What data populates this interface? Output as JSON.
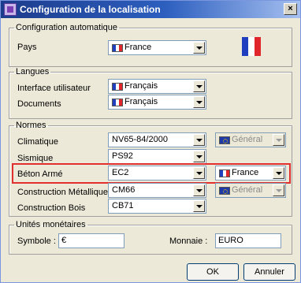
{
  "window": {
    "title": "Configuration de la localisation",
    "close_label": "×"
  },
  "auto_config": {
    "legend": "Configuration automatique",
    "pays_label": "Pays",
    "pays_value": "France"
  },
  "langues": {
    "legend": "Langues",
    "interface_label": "Interface utilisateur",
    "interface_value": "Français",
    "documents_label": "Documents",
    "documents_value": "Français"
  },
  "normes": {
    "legend": "Normes",
    "rows": [
      {
        "label": "Climatique",
        "value": "NV65-84/2000",
        "secondary": "Général"
      },
      {
        "label": "Sismique",
        "value": "PS92"
      },
      {
        "label": "Béton Armé",
        "value": "EC2",
        "secondary": "France"
      },
      {
        "label": "Construction Métallique",
        "value": "CM66",
        "secondary": "Général"
      },
      {
        "label": "Construction Bois",
        "value": "CB71"
      }
    ]
  },
  "monnaie": {
    "legend": "Unités monétaires",
    "symbole_label": "Symbole :",
    "symbole_value": "€",
    "monnaie_label": "Monnaie :",
    "monnaie_value": "EURO"
  },
  "buttons": {
    "ok": "OK",
    "cancel": "Annuler"
  },
  "icons": {
    "app": "app-icon",
    "flag_france": "flag-france-icon",
    "flag_eu": "flag-eu-icon",
    "dropdown": "chevron-down-icon"
  },
  "colors": {
    "highlight": "#e03030",
    "title_bar": "#2d5fbf"
  }
}
